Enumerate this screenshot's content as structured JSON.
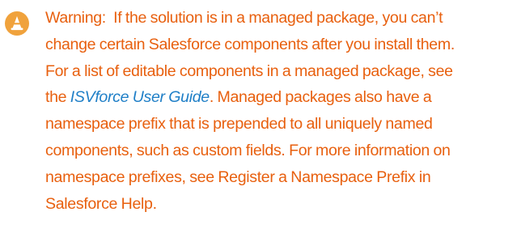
{
  "callout": {
    "icon": "warning-cone-icon",
    "accent_color": "#e8600f",
    "icon_bg_color": "#f0a23c",
    "link_color": "#1f7fc7",
    "label": "Warning:",
    "line1_text": "If the solution is in a managed package, you can’t",
    "line2": "change certain Salesforce components after you install them.",
    "line3": "For a list of editable components in a managed package, see",
    "line4_pre": "the ",
    "link_text": "ISVforce User Guide",
    "line4_post": ". Managed packages also have a",
    "line5": "namespace prefix that is prepended to all uniquely named",
    "line6": "components, such as custom fields. For more information on",
    "line7": "namespace prefixes, see Register a Namespace Prefix in",
    "line8": "Salesforce Help."
  }
}
